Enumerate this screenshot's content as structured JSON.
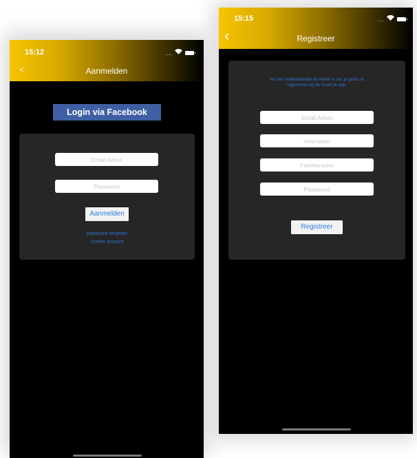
{
  "login": {
    "time": "15:12",
    "title": "Aanmelden",
    "back": "<",
    "facebook_label": "Login via Facebook",
    "email_placeholder": "Email Adres",
    "password_placeholder": "Paswoord",
    "submit_label": "Aanmelden",
    "forgot_label": "paswoord vergeten",
    "create_label": "Creëer account"
  },
  "register": {
    "time": "15:15",
    "title": "Registreer",
    "back": "‹",
    "info_line1": "Vul het onderstaande formulier is om je gratis te",
    "info_line2": "registreren bij de FootCal app.",
    "email_placeholder": "Email Adres",
    "firstname_placeholder": "Voornaam",
    "lastname_placeholder": "Familienaam",
    "password_placeholder": "Paswoord",
    "submit_label": "Registreer"
  },
  "status": {
    "signal": "....",
    "wifi_icon": "wifi-icon",
    "battery_icon": "battery-icon"
  },
  "colors": {
    "accent_gold": "#f6c400",
    "facebook_blue": "#3f5fa4",
    "link_blue": "#2d74d6",
    "card_bg": "#262626"
  }
}
